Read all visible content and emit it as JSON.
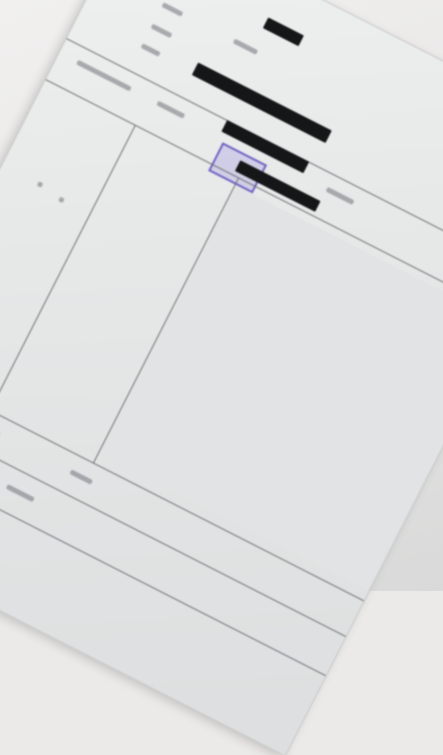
{
  "document": {
    "header_title": "",
    "rows": [
      {
        "label": "",
        "value": ""
      },
      {
        "label": "",
        "value": ""
      },
      {
        "label": "",
        "value": ""
      },
      {
        "label": "",
        "value": ""
      }
    ],
    "info_row": {
      "label": "",
      "middle": "",
      "right": ""
    },
    "stamp_text": "",
    "footer": {
      "label_1": "",
      "value_1": "",
      "label_2": "",
      "value_2": "",
      "label_3": ""
    }
  },
  "colors": {
    "paper": "#e6e7e7",
    "ink": "#505458",
    "stamp": "#6f64c4",
    "redaction": "#151617"
  }
}
